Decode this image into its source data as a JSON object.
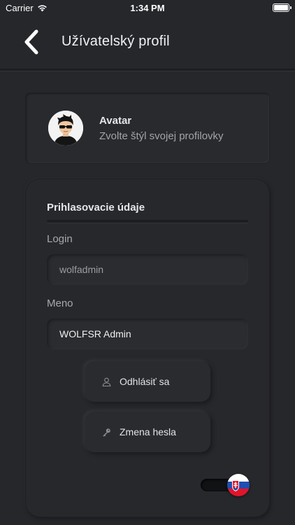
{
  "status_bar": {
    "carrier": "Carrier",
    "time": "1:34 PM",
    "battery_level": 1.0
  },
  "header": {
    "title": "Užívatelský profil",
    "back_icon": "chevron-left-icon"
  },
  "avatar_card": {
    "title": "Avatar",
    "subtitle": "Zvolte štýl svojej profilovky"
  },
  "login_panel": {
    "heading": "Prihlasovacie údaje",
    "login_label": "Login",
    "login_value": "wolfadmin",
    "name_label": "Meno",
    "name_value": "WOLFSR Admin",
    "logout_label": "Odhlásiť sa",
    "logout_icon": "user-icon",
    "change_password_label": "Zmena hesla",
    "change_password_icon": "key-icon"
  },
  "language_toggle": {
    "flag": "slovakia-flag-icon"
  },
  "colors": {
    "background": "#26272b",
    "panel": "#27282c",
    "text_primary": "#e6e6e8",
    "text_secondary": "#a3a4a8"
  }
}
